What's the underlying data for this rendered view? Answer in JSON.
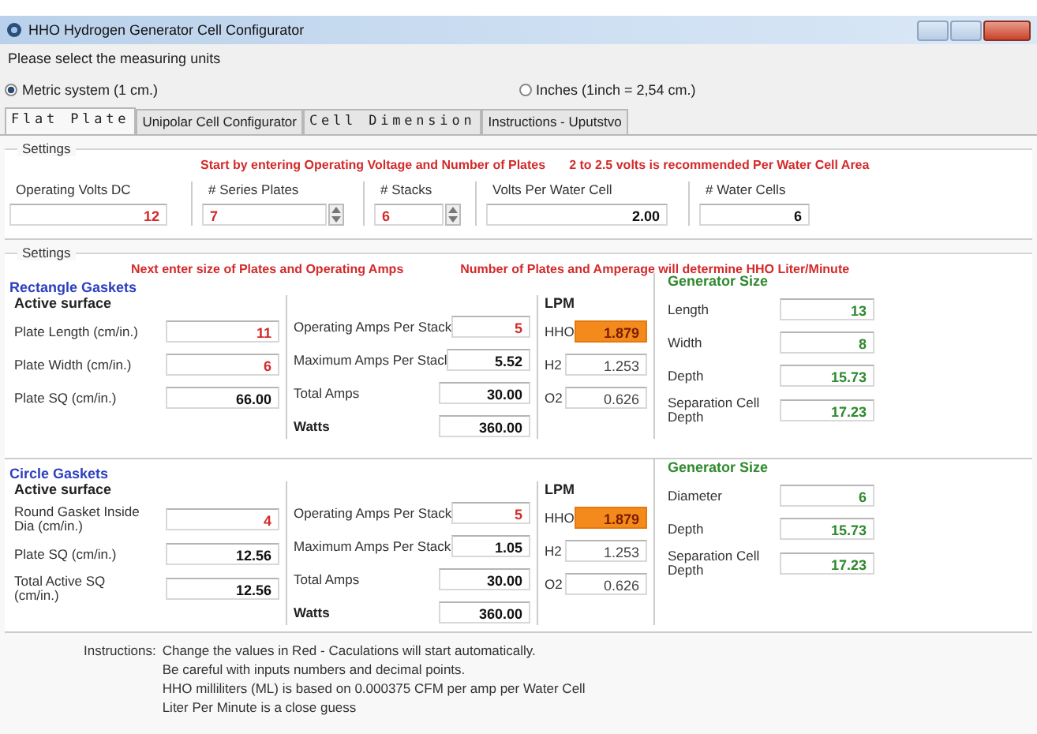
{
  "window": {
    "title": "HHO Hydrogen Generator Cell Configurator"
  },
  "units": {
    "prompt": "Please select the measuring units",
    "options": [
      {
        "label": "Metric system (1 cm.)",
        "selected": true
      },
      {
        "label": "Inches (1inch = 2,54 cm.)",
        "selected": false
      }
    ]
  },
  "tabs": [
    {
      "label": "Flat Plate",
      "selected": true,
      "spaced": true
    },
    {
      "label": "Unipolar Cell Configurator",
      "selected": false,
      "spaced": false
    },
    {
      "label": "Cell Dimension",
      "selected": false,
      "spaced": true
    },
    {
      "label": "Instructions - Uputstvo",
      "selected": false,
      "spaced": false
    }
  ],
  "voltage_settings": {
    "title": "Settings",
    "notes": [
      "Start by entering Operating Voltage and Number of Plates",
      "2 to 2.5 volts is recommended Per Water Cell Area"
    ],
    "fields": [
      {
        "label": "Operating Volts DC",
        "value": "12",
        "kind": "input"
      },
      {
        "label": "# Series Plates",
        "value": "7",
        "kind": "spinner"
      },
      {
        "label": "# Stacks",
        "value": "6",
        "kind": "spinner"
      },
      {
        "label": "Volts Per Water Cell",
        "value": "2.00",
        "kind": "output"
      },
      {
        "label": "# Water Cells",
        "value": "6",
        "kind": "output"
      }
    ]
  },
  "plate_settings": {
    "title": "Settings",
    "notes": [
      "Next enter size of Plates and Operating Amps",
      "Number of Plates and Amperage will determine HHO Liter/Minute"
    ],
    "sections": [
      {
        "title": "Rectangle Gaskets",
        "surface_heading": "Active surface",
        "lpm_heading": "LPM",
        "generator_heading": "Generator Size",
        "surface": [
          {
            "label": "Plate Length (cm/in.)",
            "value": "11",
            "kind": "input"
          },
          {
            "label": "Plate Width (cm/in.)",
            "value": "6",
            "kind": "input"
          },
          {
            "label": "Plate SQ (cm/in.)",
            "value": "66.00",
            "kind": "output"
          }
        ],
        "amps": [
          {
            "label": "Operating Amps Per Stack",
            "value": "5",
            "kind": "input",
            "bold": false
          },
          {
            "label": "Maximum Amps Per Stacl",
            "value": "5.52",
            "kind": "output",
            "bold": false
          },
          {
            "label": "Total Amps",
            "value": "30.00",
            "kind": "output",
            "bold": false
          },
          {
            "label": "Watts",
            "value": "360.00",
            "kind": "output",
            "bold": true
          }
        ],
        "lpm": [
          {
            "label": "HHO",
            "value": "1.879",
            "kind": "highlight"
          },
          {
            "label": "H2",
            "value": "1.253",
            "kind": "plain"
          },
          {
            "label": "O2",
            "value": "0.626",
            "kind": "plain"
          }
        ],
        "generator": [
          {
            "label": "Length",
            "value": "13",
            "kind": "generator"
          },
          {
            "label": "Width",
            "value": "8",
            "kind": "generator"
          },
          {
            "label": "Depth",
            "value": "15.73",
            "kind": "generator"
          },
          {
            "label": "Separation Cell Depth",
            "value": "17.23",
            "kind": "generator"
          }
        ]
      },
      {
        "title": "Circle Gaskets",
        "surface_heading": "Active surface",
        "lpm_heading": "LPM",
        "generator_heading": "Generator Size",
        "surface": [
          {
            "label": "Round Gasket Inside Dia (cm/in.)",
            "value": "4",
            "kind": "input"
          },
          {
            "label": "Plate SQ (cm/in.)",
            "value": "12.56",
            "kind": "output"
          },
          {
            "label": "Total Active SQ (cm/in.)",
            "value": "12.56",
            "kind": "output"
          }
        ],
        "amps": [
          {
            "label": "Operating Amps Per Stack",
            "value": "5",
            "kind": "input",
            "bold": false
          },
          {
            "label": "Maximum Amps Per Stack",
            "value": "1.05",
            "kind": "output",
            "bold": false
          },
          {
            "label": "Total Amps",
            "value": "30.00",
            "kind": "output",
            "bold": false
          },
          {
            "label": "Watts",
            "value": "360.00",
            "kind": "output",
            "bold": true
          }
        ],
        "lpm": [
          {
            "label": "HHO",
            "value": "1.879",
            "kind": "highlight"
          },
          {
            "label": "H2",
            "value": "1.253",
            "kind": "plain"
          },
          {
            "label": "O2",
            "value": "0.626",
            "kind": "plain"
          }
        ],
        "generator": [
          {
            "label": "Diameter",
            "value": "6",
            "kind": "generator"
          },
          {
            "label": "Depth",
            "value": "15.73",
            "kind": "generator"
          },
          {
            "label": "Separation Cell Depth",
            "value": "17.23",
            "kind": "generator"
          }
        ]
      }
    ]
  },
  "instructions": {
    "label": "Instructions:",
    "lines": [
      "Change the values in Red  - Caculations will start automatically.",
      "Be careful with inputs numbers and decimal points.",
      "HHO milliliters (ML) is based on 0.000375 CFM per amp per Water Cell",
      "Liter Per Minute is a close guess"
    ]
  }
}
